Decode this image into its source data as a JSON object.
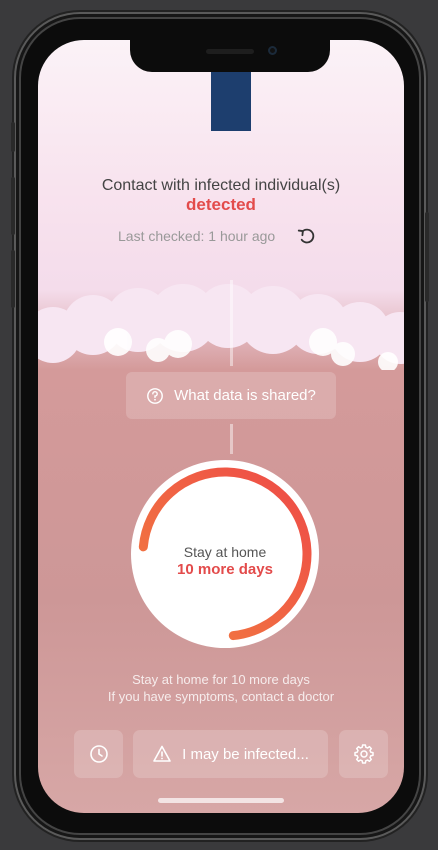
{
  "flag": {
    "color": "#1d3e6e"
  },
  "status": {
    "line1": "Contact with infected individual(s)",
    "line2": "detected",
    "last_checked": "Last checked: 1 hour ago",
    "refresh_icon": "refresh-icon",
    "alert_color": "#e34b4b"
  },
  "shared_button": {
    "icon": "help-circle-icon",
    "label": "What data is shared?"
  },
  "countdown": {
    "label": "Stay at home",
    "days_text": "10 more days",
    "days_remaining": 10,
    "progress_fraction": 0.72,
    "gradient": [
      "#ee4b47",
      "#f27d40"
    ]
  },
  "info": {
    "line1": "Stay at home for 10 more days",
    "line2": "If you have symptoms, contact a doctor"
  },
  "bottom_bar": {
    "history_icon": "clock-icon",
    "infected_icon": "warning-icon",
    "infected_label": "I may be infected...",
    "settings_icon": "gear-icon"
  }
}
